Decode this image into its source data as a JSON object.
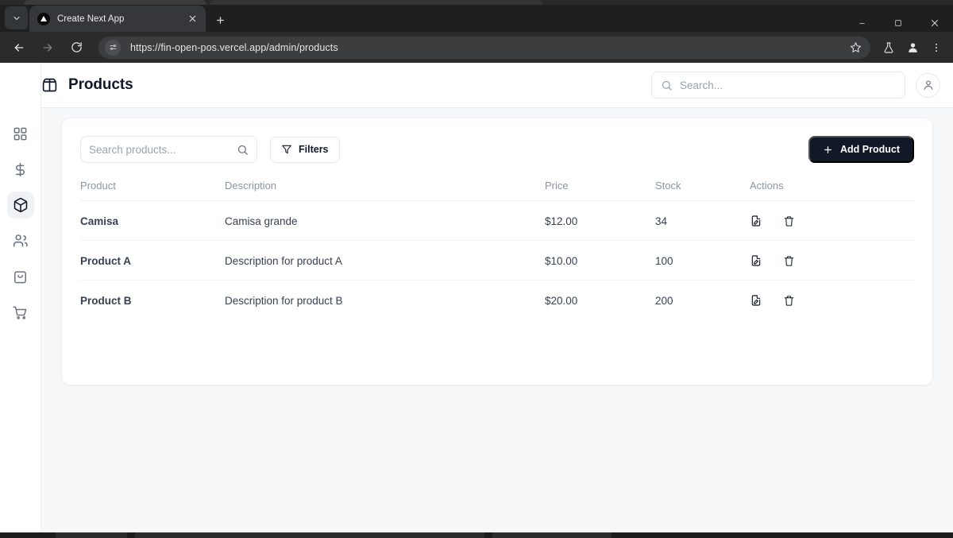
{
  "browser": {
    "tab": {
      "title": "Create Next App",
      "favicon": "nextjs-triangle-icon",
      "close_icon": "close-icon"
    },
    "tab_list_icon": "chevron-down-icon",
    "new_tab_icon": "plus-icon",
    "window_controls": {
      "minimize": "minimize-icon",
      "maximize": "maximize-icon",
      "close": "close-icon"
    },
    "nav": {
      "back": "back-arrow-icon",
      "forward": "forward-arrow-icon",
      "reload": "reload-icon"
    },
    "omnibox": {
      "site_settings_icon": "site-settings-icon",
      "url": "https://fin-open-pos.vercel.app/admin/products",
      "bookmark_icon": "star-icon"
    },
    "toolbar_icons": [
      "flask-icon",
      "profile-icon",
      "more-vertical-icon"
    ]
  },
  "sidebar": {
    "items": [
      {
        "name": "dashboard",
        "icon": "grid-dashboard-icon",
        "active": false
      },
      {
        "name": "finances",
        "icon": "dollar-sign-icon",
        "active": false
      },
      {
        "name": "products",
        "icon": "package-box-icon",
        "active": true
      },
      {
        "name": "customers",
        "icon": "users-icon",
        "active": false
      },
      {
        "name": "orders",
        "icon": "shopping-bag-icon",
        "active": false
      },
      {
        "name": "cart",
        "icon": "shopping-cart-icon",
        "active": false
      }
    ]
  },
  "header": {
    "icon": "package-box-icon",
    "title": "Products",
    "search": {
      "icon": "search-icon",
      "placeholder": "Search...",
      "value": ""
    },
    "account_icon": "user-circle-icon"
  },
  "toolbar": {
    "product_search": {
      "placeholder": "Search products...",
      "value": "",
      "icon": "search-icon"
    },
    "filters_label": "Filters",
    "filters_icon": "funnel-icon",
    "add_label": "Add Product",
    "add_icon": "plus-icon"
  },
  "table": {
    "columns": [
      "Product",
      "Description",
      "Price",
      "Stock",
      "Actions"
    ],
    "rows": [
      {
        "name": "Camisa",
        "description": "Camisa grande",
        "price": "$12.00",
        "stock": "34"
      },
      {
        "name": "Product A",
        "description": "Description for product A",
        "price": "$10.00",
        "stock": "100"
      },
      {
        "name": "Product B",
        "description": "Description for product B",
        "price": "$20.00",
        "stock": "200"
      }
    ],
    "row_actions": {
      "edit_icon": "file-pen-edit-icon",
      "delete_icon": "trash-icon"
    }
  },
  "colors": {
    "accent": "#111827",
    "page_bg": "#f7f8fa",
    "card_bg": "#ffffff",
    "muted_text": "#8b94a3",
    "chrome_bg": "#1f1f1f"
  }
}
